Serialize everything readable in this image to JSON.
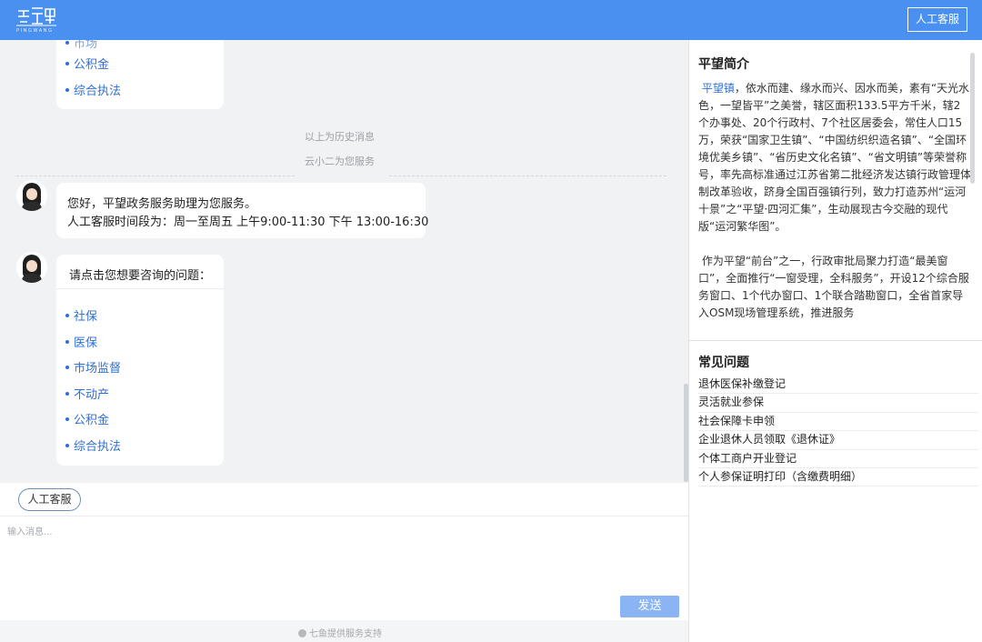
{
  "header": {
    "logo_text": "PINGWANG",
    "human_service_button": "人工客服"
  },
  "chat": {
    "history_menu_items": [
      "公积金",
      "综合执法"
    ],
    "divider_label": "以上为历史消息",
    "service_by_label": "云小二为您服务",
    "greeting": {
      "line1": "您好，平望政务服务助理为您服务。",
      "line2": "人工客服时间段为：周一至周五 上午9:00-11:30 下午 13:00-16:30"
    },
    "question_prompt": "请点击您想要咨询的问题：",
    "question_items": [
      "社保",
      "医保",
      "市场监督",
      "不动产",
      "公积金",
      "综合执法"
    ]
  },
  "composer": {
    "human_service_pill": "人工客服",
    "placeholder": "输入消息...",
    "send_label": "发送",
    "footer": "七鱼提供服务支持"
  },
  "right_panel": {
    "intro_title": "平望简介",
    "intro_highlight": "平望镇",
    "intro_p1": "，依水而建、缘水而兴、因水而美，素有“天光水色，一望皆平”之美誉，辖区面积133.5平方千米，辖2个办事处、20个行政村、7个社区居委会，常住人口15万，荣获“国家卫生镇”、“中国纺织织造名镇”、“全国环境优美乡镇”、“省历史文化名镇”、“省文明镇”等荣誉称号，率先高标准通过江苏省第二批经济发达镇行政管理体制改革验收，跻身全国百强镇行列，致力打造苏州“运河十景”之“平望·四河汇集”，生动展现古今交融的现代版“运河繁华图”。",
    "intro_p2": "作为平望“前台”之一，行政审批局聚力打造“最美窗口”，全面推行“一窗受理，全科服务”，开设12个综合服务窗口、1个代办窗口、1个联合踏勘窗口，全省首家导入OSM现场管理系统，推进服务",
    "faq_title": "常见问题",
    "faq_items": [
      "退休医保补缴登记",
      "灵活就业参保",
      "社会保障卡申领",
      "企业退休人员领取《退休证》",
      "个体工商户开业登记",
      "个人参保证明打印（含缴费明细）"
    ]
  },
  "colors": {
    "brand_blue": "#4a90f0",
    "link_blue": "#2d6fd8",
    "send_button": "#8ab4f3",
    "chat_bg": "#f1f2f4"
  }
}
